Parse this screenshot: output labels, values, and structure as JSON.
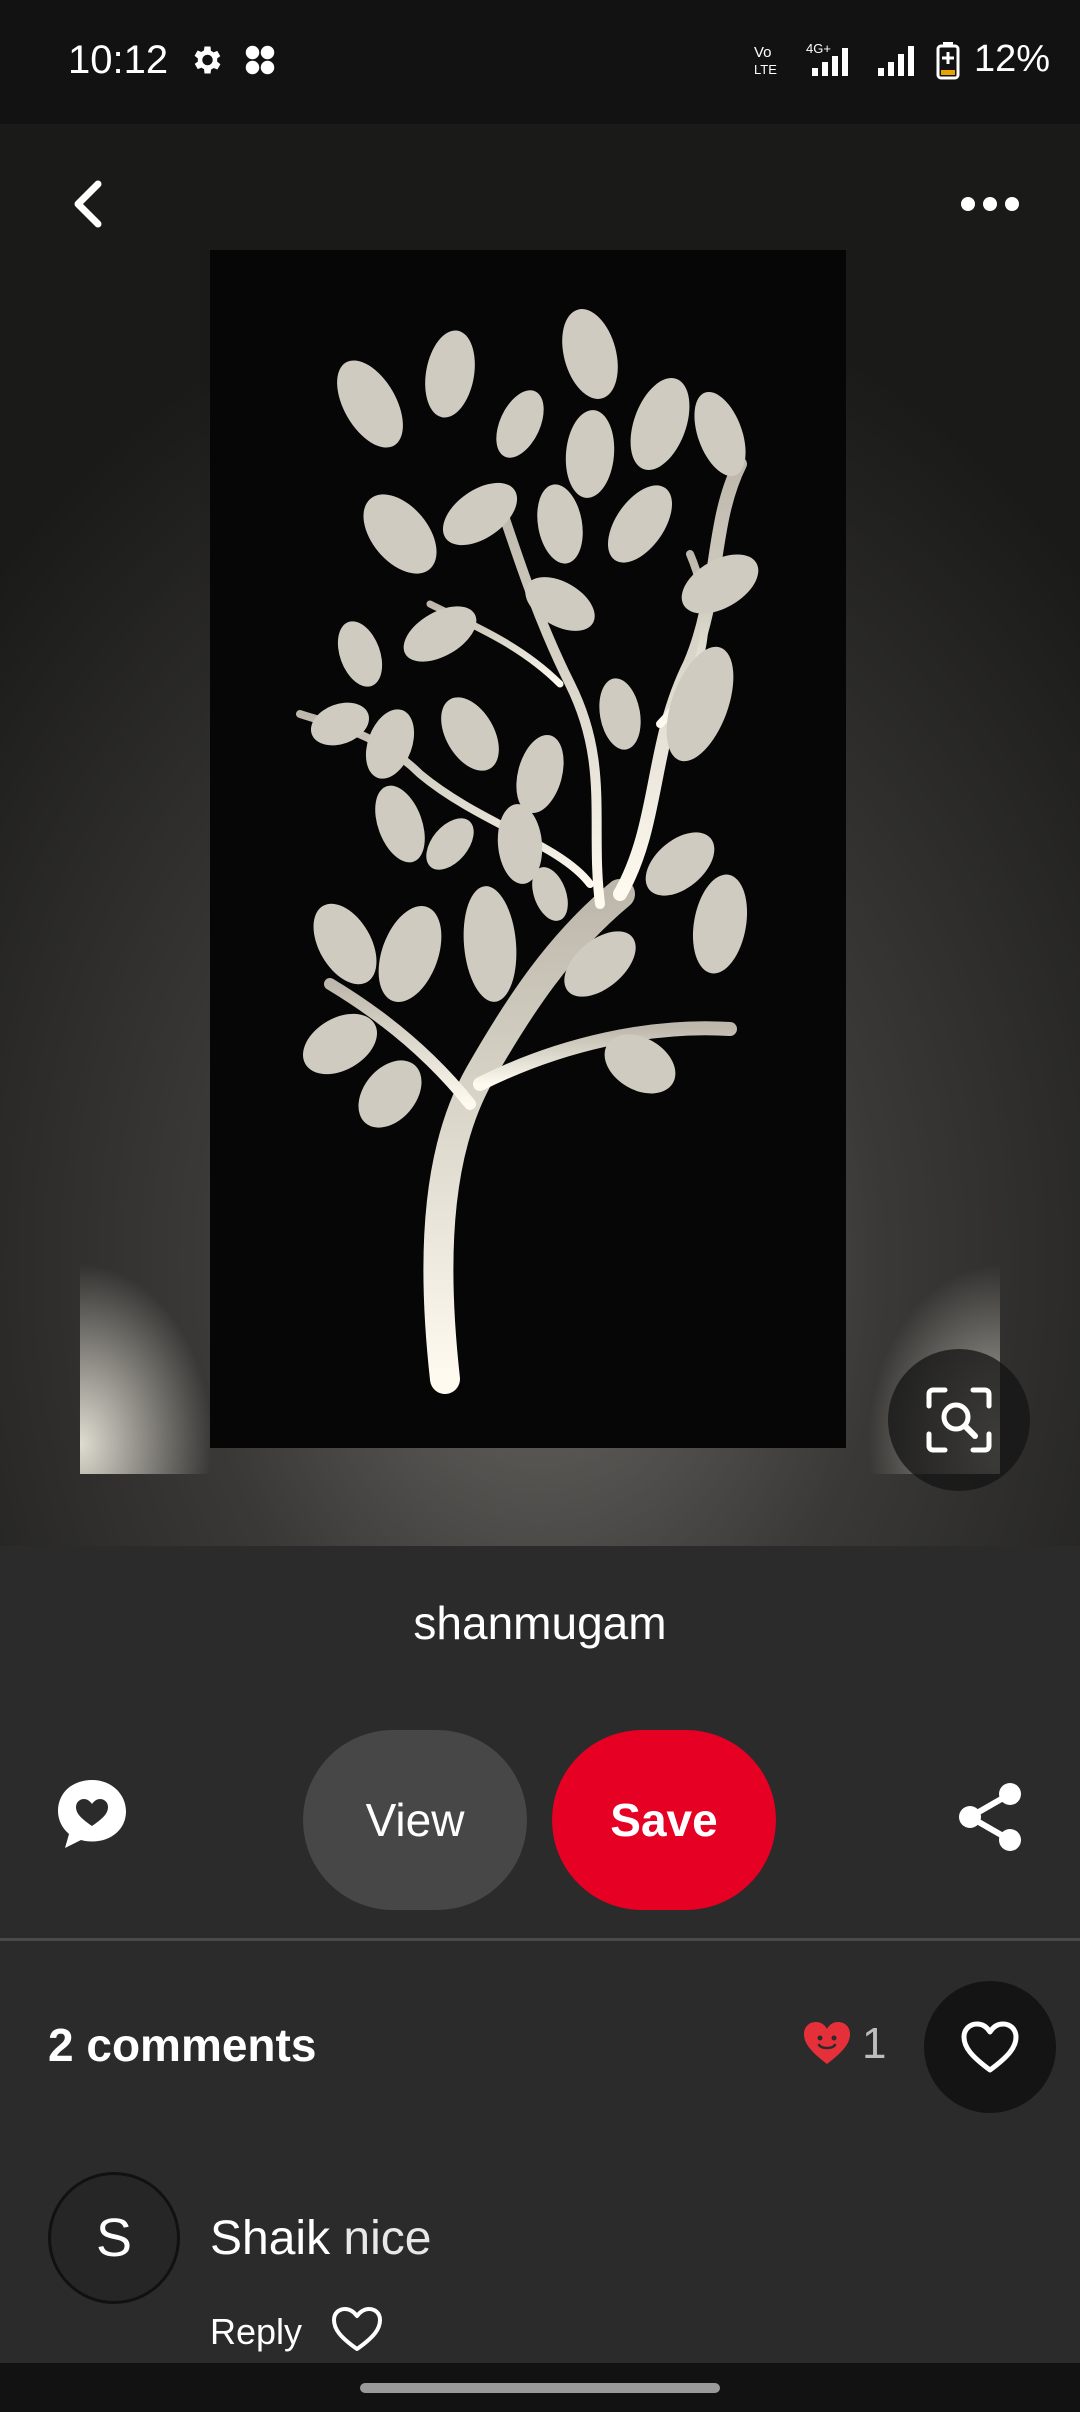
{
  "status_bar": {
    "time": "10:12",
    "battery_text": "12%",
    "icons": [
      "settings-icon",
      "app-icon",
      "volte-icon",
      "4g-signal-icon",
      "signal-icon",
      "battery-icon"
    ]
  },
  "hero": {
    "icons": [
      "back-arrow-icon",
      "more-options-icon",
      "visual-search-icon"
    ]
  },
  "pin": {
    "author": "shanmugam",
    "view_label": "View",
    "save_label": "Save",
    "icons": [
      "reaction-heart-bubble-icon",
      "share-icon"
    ]
  },
  "comments": {
    "title": "2 comments",
    "reaction_count": "1",
    "items": [
      {
        "avatar_initial": "S",
        "user": "Shaik",
        "text": "nice",
        "reply_label": "Reply"
      }
    ]
  },
  "colors": {
    "background": "#282828",
    "save_button": "#e60023",
    "view_button": "#474747",
    "reaction_heart": "#e5303a"
  }
}
